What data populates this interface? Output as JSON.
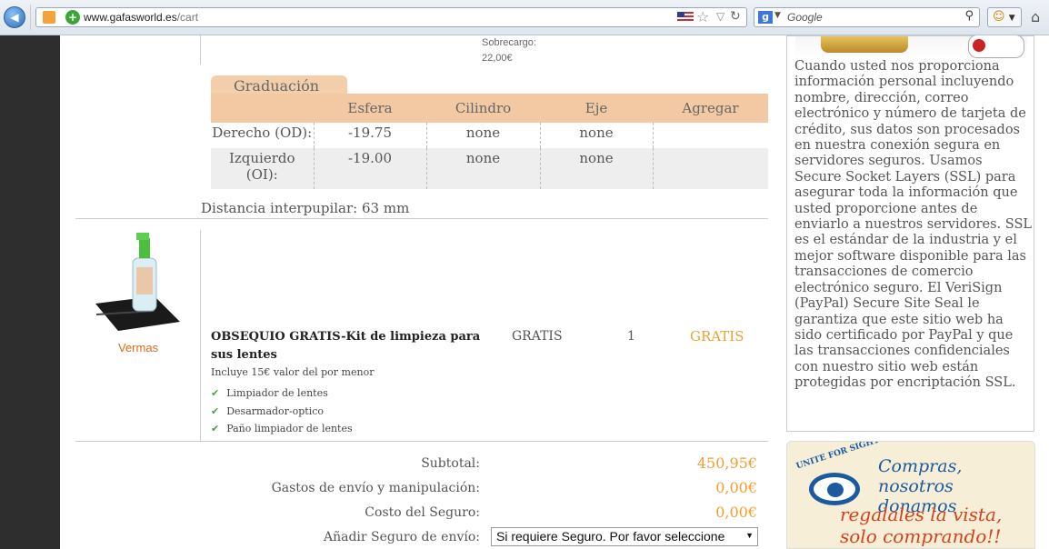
{
  "browser": {
    "url_domain": "www.gafasworld.es",
    "url_path": "/cart",
    "search_engine": "Google",
    "search_placeholder": "Google"
  },
  "item_top": {
    "surcharge_label": "Sobrecargo:",
    "surcharge_value": "22,00€"
  },
  "prescription": {
    "tab_label": "Graduación",
    "headers": [
      "",
      "Esfera",
      "Cilindro",
      "Eje",
      "Agregar"
    ],
    "rows": [
      {
        "label": "Derecho (OD):",
        "esfera": "-19.75",
        "cilindro": "none",
        "eje": "none",
        "agregar": ""
      },
      {
        "label": "Izquierdo (OI):",
        "esfera": "-19.00",
        "cilindro": "none",
        "eje": "none",
        "agregar": ""
      }
    ],
    "pd_text": "Distancia interpupilar: 63 mm"
  },
  "gift": {
    "more_link": "Vermas",
    "title": "OBSEQUIO GRATIS-Kit de limpieza para sus lentes",
    "subtitle": "Incluye 15€ valor del por menor",
    "bullets": [
      "Limpiador de lentes",
      "Desarmador-optico",
      "Paño limpiador de lentes"
    ],
    "price": "GRATIS",
    "qty": "1",
    "total": "GRATIS"
  },
  "summary": {
    "subtotal_label": "Subtotal:",
    "subtotal_value": "450,95€",
    "shipping_label": "Gastos de envío y manipulación:",
    "shipping_value": "0,00€",
    "insurance_label": "Costo del Seguro:",
    "insurance_value": "0,00€",
    "add_insurance_label": "Añadir Seguro de envío:",
    "add_insurance_selected": "Si requiere Seguro. Por favor seleccione"
  },
  "sidebar": {
    "ssl_text": "Cuando usted nos proporciona información personal incluyendo nombre, dirección, correo electrónico y número de tarjeta de crédito, sus datos son procesados en nuestra conexión segura en servidores seguros. Usamos Secure Socket Layers (SSL) para asegurar toda la información que usted proporcione antes de enviarlo a nuestros servidores. SSL es el estándar de la industria y el mejor software disponible para las transacciones de comercio electrónico seguro. El VeriSign (PayPal) Secure Site Seal le garantiza que este sitio web ha sido certificado por PayPal y que las transacciones confidenciales con nuestro sitio web están protegidas por encriptación SSL.",
    "banner_logo": "UNITE FOR SIGHT",
    "banner_line1": "Compras, nosotros donamos",
    "banner_line2": "regalales la vista, solo comprando!!"
  },
  "colors": {
    "accent_orange": "#f0a030",
    "table_header": "#f2c9a2",
    "check_green": "#45a542",
    "link_orange": "#e0691b"
  }
}
